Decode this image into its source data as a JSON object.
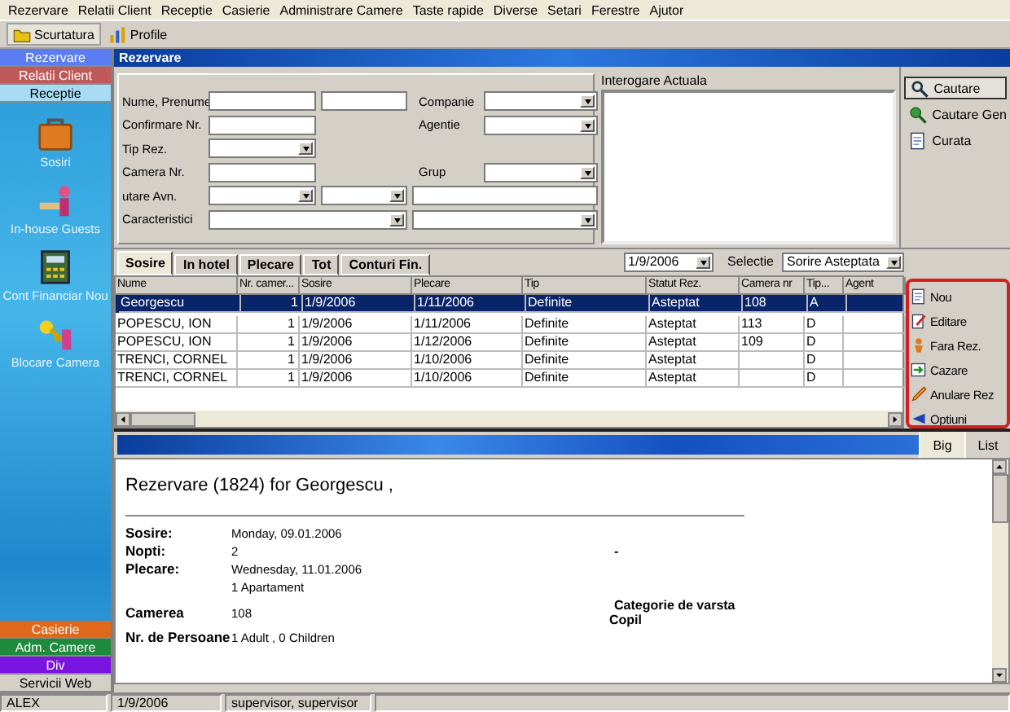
{
  "menu": [
    "Rezervare",
    "Relatii Client",
    "Receptie",
    "Casierie",
    "Administrare Camere",
    "Taste rapide",
    "Diverse",
    "Setari",
    "Ferestre",
    "Ajutor"
  ],
  "toolbar": [
    "Scurtatura",
    "Profile"
  ],
  "sidebar": {
    "top": [
      {
        "label": "Rezervare",
        "color": "#5b7cf2"
      },
      {
        "label": "Relatii Client",
        "color": "#c05a5a"
      },
      {
        "label": "Receptie",
        "color": "#a8dcf4"
      }
    ],
    "shortcuts": [
      "Sosiri",
      "In-house Guests",
      "Cont Financiar Nou",
      "Blocare Camera"
    ],
    "bottom": [
      {
        "label": "Casierie",
        "color": "#e0681c"
      },
      {
        "label": "Adm. Camere",
        "color": "#1e8a3c"
      },
      {
        "label": "Div",
        "color": "#7a14e0"
      },
      {
        "label": "Servicii Web",
        "color": "#d4d0c8"
      }
    ]
  },
  "window_title": "Rezervare",
  "search_form": {
    "rows": [
      {
        "label": "Nume, Prenume",
        "controls": [
          {
            "kind": "text"
          },
          {
            "kind": "text"
          }
        ],
        "side": {
          "label": "Companie",
          "kind": "dropdown"
        }
      },
      {
        "label": "Confirmare Nr.",
        "controls": [
          {
            "kind": "text"
          }
        ],
        "side": {
          "label": "Agentie",
          "kind": "dropdown"
        }
      },
      {
        "label": "Tip Rez.",
        "controls": [
          {
            "kind": "dropdown"
          }
        ]
      },
      {
        "label": "Camera Nr.",
        "controls": [
          {
            "kind": "text"
          }
        ],
        "side": {
          "label": "Grup",
          "kind": "dropdown"
        }
      },
      {
        "label": "utare Avn.",
        "controls": [
          {
            "kind": "dropdown"
          },
          {
            "kind": "dropdown"
          },
          {
            "kind": "text"
          }
        ]
      },
      {
        "label": "Caracteristici",
        "controls": [
          {
            "kind": "dropdown-wide"
          },
          {
            "kind": "dropdown"
          }
        ]
      }
    ],
    "query_label": "Interogare Actuala"
  },
  "search_buttons": [
    {
      "label": "Cautare",
      "default": true
    },
    {
      "label": "Cautare Gen",
      "default": false
    },
    {
      "label": "Curata",
      "default": false
    }
  ],
  "tabs": [
    {
      "label": "Sosire",
      "selected": true
    },
    {
      "label": "In hotel",
      "selected": false
    },
    {
      "label": "Plecare",
      "selected": false
    },
    {
      "label": "Tot",
      "selected": false
    },
    {
      "label": "Conturi Fin.",
      "selected": false
    }
  ],
  "date_filter": "1/9/2006",
  "selection_label": "Selectie",
  "selection_value": "Sorire Asteptata",
  "table": {
    "columns": [
      "Nume",
      "Nr. camer...",
      "Sosire",
      "Plecare",
      "Tip",
      "Statut Rez.",
      "Camera nr",
      "Tip...",
      "Agent"
    ],
    "rows": [
      {
        "cells": [
          "Georgescu",
          "1",
          "1/9/2006",
          "1/11/2006",
          "Definite",
          "Asteptat",
          "108",
          "A"
        ],
        "selected": true
      },
      {
        "cells": [
          "POPESCU, ION",
          "1",
          "1/9/2006",
          "1/11/2006",
          "Definite",
          "Asteptat",
          "113",
          "D"
        ],
        "selected": false
      },
      {
        "cells": [
          "POPESCU, ION",
          "1",
          "1/9/2006",
          "1/12/2006",
          "Definite",
          "Asteptat",
          "109",
          "D"
        ],
        "selected": false
      },
      {
        "cells": [
          "TRENCI, CORNEL",
          "1",
          "1/9/2006",
          "1/10/2006",
          "Definite",
          "Asteptat",
          "",
          "D"
        ],
        "selected": false
      },
      {
        "cells": [
          "TRENCI, CORNEL",
          "1",
          "1/9/2006",
          "1/10/2006",
          "Definite",
          "Asteptat",
          "",
          "D"
        ],
        "selected": false
      }
    ]
  },
  "actions": [
    "Nou",
    "Editare",
    "Fara Rez.",
    "Cazare",
    "Anulare Rez",
    "Optiuni"
  ],
  "view_tabs": [
    {
      "label": "Big",
      "selected": true
    },
    {
      "label": "List",
      "selected": false
    }
  ],
  "detail": {
    "title": "Rezervare (1824) for Georgescu ,",
    "rows": [
      {
        "label": "Sosire:",
        "value": "Monday, 09.01.2006"
      },
      {
        "label": "Nopti:",
        "value": "2",
        "extra": "-"
      },
      {
        "label": "Plecare:",
        "value": "Wednesday, 11.01.2006"
      },
      {
        "value": "1 Apartament"
      },
      {
        "label": "Camerea",
        "value": "108",
        "extra": "Categorie de varsta",
        "extra_2": "Copil"
      },
      {
        "label": "Nr. de Persoane",
        "value": "1 Adult , 0 Children"
      }
    ]
  },
  "status_bar": [
    "ALEX",
    "1/9/2006",
    "supervisor, supervisor"
  ]
}
